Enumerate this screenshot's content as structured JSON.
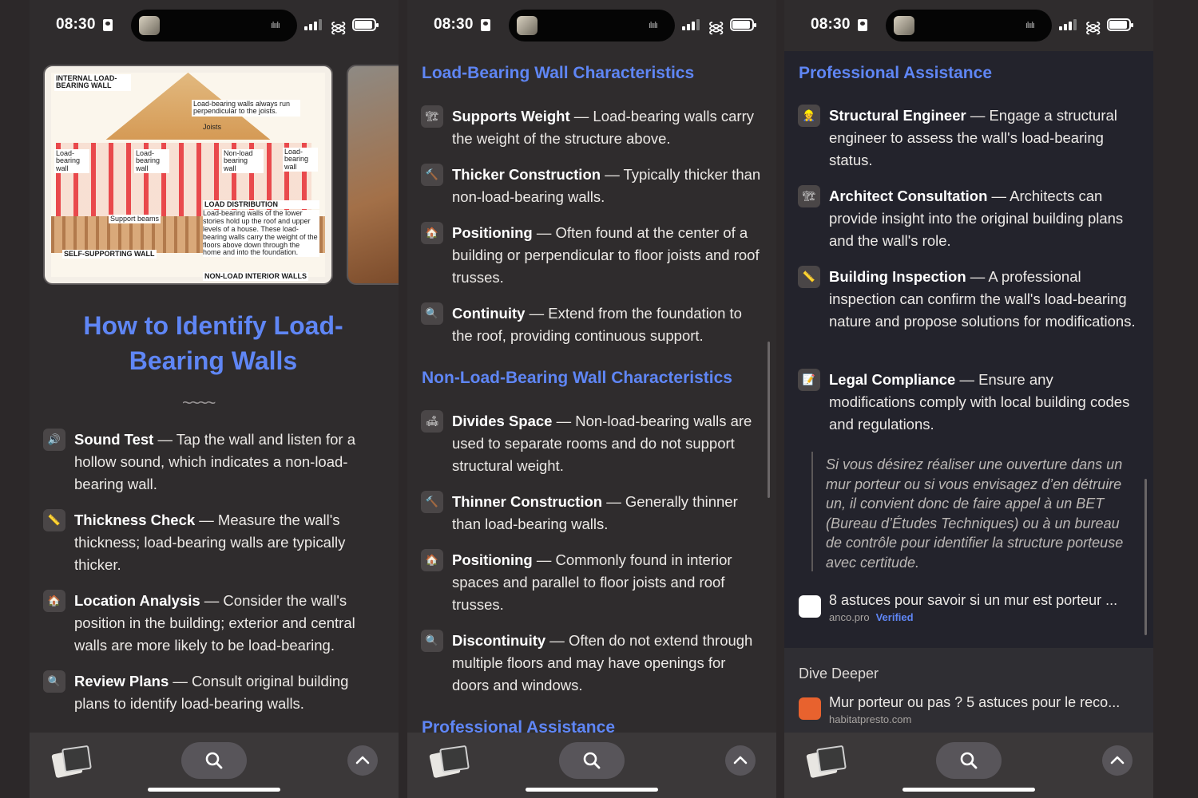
{
  "status": {
    "time": "08:30"
  },
  "screen1": {
    "diagram": {
      "title": "INTERNAL LOAD-BEARING WALL",
      "note": "Load-bearing walls always run perpendicular to the joists.",
      "joists": "Joists",
      "label_lb1": "Load-bearing wall",
      "label_lb2": "Load-bearing wall",
      "label_nlb": "Non-load bearing wall",
      "label_lb3": "Load-bearing wall",
      "load_title": "LOAD DISTRIBUTION",
      "load_text": "Load-bearing walls of the lower stories hold up the roof and upper levels of a house. These load-bearing walls carry the weight of the floors above down through the home and into the foundation.",
      "support": "Support beams",
      "self": "SELF-SUPPORTING WALL",
      "nonload": "NON-LOAD INTERIOR WALLS"
    },
    "title": "How to Identify Load-Bearing Walls",
    "squiggle": "~~~~",
    "items": [
      {
        "icon": "🔊",
        "bold": "Sound Test",
        "text": " — Tap the wall and listen for a hollow sound, which indicates a non-load-bearing wall."
      },
      {
        "icon": "📏",
        "bold": "Thickness Check",
        "text": " — Measure the wall's thickness; load-bearing walls are typically thicker."
      },
      {
        "icon": "🏠",
        "bold": "Location Analysis",
        "text": " — Consider the wall's position in the building; exterior and central walls are more likely to be load-bearing."
      },
      {
        "icon": "🔍",
        "bold": "Review Plans",
        "text": " — Consult original building plans to identify load-bearing walls."
      }
    ]
  },
  "screen2": {
    "section1": "Load-Bearing Wall Characteristics",
    "items1": [
      {
        "icon": "🏗",
        "bold": "Supports Weight",
        "text": " — Load-bearing walls carry the weight of the structure above."
      },
      {
        "icon": "🔨",
        "bold": "Thicker Construction",
        "text": " — Typically thicker than non-load-bearing walls."
      },
      {
        "icon": "🏠",
        "bold": "Positioning",
        "text": " — Often found at the center of a building or perpendicular to floor joists and roof trusses."
      },
      {
        "icon": "🔍",
        "bold": "Continuity",
        "text": " — Extend from the foundation to the roof, providing continuous support."
      }
    ],
    "section2": "Non-Load-Bearing Wall Characteristics",
    "items2": [
      {
        "icon": "🛋",
        "bold": "Divides Space",
        "text": " — Non-load-bearing walls are used to separate rooms and do not support structural weight."
      },
      {
        "icon": "🔨",
        "bold": "Thinner Construction",
        "text": " — Generally thinner than load-bearing walls."
      },
      {
        "icon": "🏠",
        "bold": "Positioning",
        "text": " — Commonly found in interior spaces and parallel to floor joists and roof trusses."
      },
      {
        "icon": "🔍",
        "bold": "Discontinuity",
        "text": " — Often do not extend through multiple floors and may have openings for doors and windows."
      }
    ],
    "section3": "Professional Assistance"
  },
  "screen3": {
    "section": "Professional Assistance",
    "items": [
      {
        "icon": "👷",
        "bold": "Structural Engineer",
        "text": " — Engage a structural engineer to assess the wall's load-bearing status."
      },
      {
        "icon": "🏗",
        "bold": "Architect Consultation",
        "text": " — Architects can provide insight into the original building plans and the wall's role."
      },
      {
        "icon": "📏",
        "bold": "Building Inspection",
        "text": " — A professional inspection can confirm the wall's load-bearing nature and propose solutions for modifications."
      },
      {
        "icon": "📝",
        "bold": "Legal Compliance",
        "text": " — Ensure any modifications comply with local building codes and regulations."
      }
    ],
    "quote": "Si vous désirez réaliser une ouverture dans un mur porteur ou si vous envisagez d’en détruire un, il convient donc de faire appel à un BET (Bureau d’Études Techniques) ou à un bureau de contrôle pour identifier la structure porteuse avec certitude.",
    "source": {
      "title": "8 astuces pour savoir si un mur est porteur ...",
      "domain": "anco.pro",
      "verified": "Verified"
    },
    "dive_title": "Dive Deeper",
    "dive_source": {
      "title": "Mur porteur ou pas ? 5 astuces pour le reco...",
      "domain": "habitatpresto.com"
    }
  },
  "colors": {
    "accent": "#5f86f5",
    "background": "#2f2c2d",
    "card": "#23232c"
  }
}
